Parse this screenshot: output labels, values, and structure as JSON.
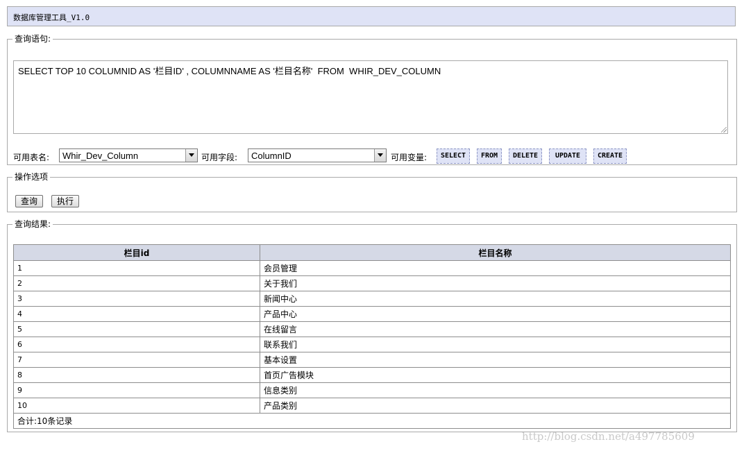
{
  "app": {
    "title": "数据库管理工具_V1.0"
  },
  "query_panel": {
    "legend": "查询语句:",
    "sql": "SELECT TOP 10 COLUMNID AS '栏目ID' , COLUMNNAME AS '栏目名称'  FROM  WHIR_DEV_COLUMN",
    "table_label": "可用表名:",
    "table_selected": "Whir_Dev_Column",
    "field_label": "可用字段:",
    "field_selected": "ColumnID",
    "vars_label": "可用变量:",
    "vars": [
      "SELECT",
      "FROM",
      "DELETE",
      "UPDATE",
      "CREATE"
    ]
  },
  "ops_panel": {
    "legend": "操作选项",
    "query_button": "查询",
    "execute_button": "执行"
  },
  "result_panel": {
    "legend": "查询结果:",
    "headers": [
      "栏目id",
      "栏目名称"
    ],
    "rows": [
      [
        "1",
        "会员管理"
      ],
      [
        "2",
        "关于我们"
      ],
      [
        "3",
        "新闻中心"
      ],
      [
        "4",
        "产品中心"
      ],
      [
        "5",
        "在线留言"
      ],
      [
        "6",
        "联系我们"
      ],
      [
        "7",
        "基本设置"
      ],
      [
        "8",
        "首页广告模块"
      ],
      [
        "9",
        "信息类别"
      ],
      [
        "10",
        "产品类别"
      ]
    ],
    "footer": "合计:10条记录"
  },
  "watermark": "http://blog.csdn.net/a497785609"
}
